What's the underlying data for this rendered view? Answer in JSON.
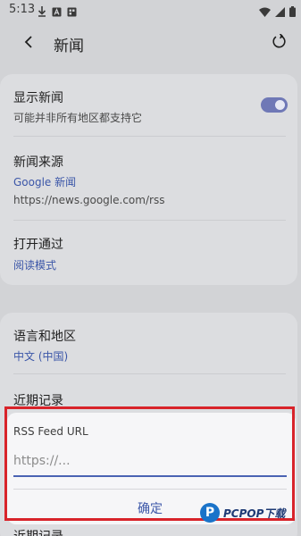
{
  "status_bar": {
    "time": "5:13",
    "icons": [
      "download-icon",
      "text-a-icon",
      "grid-app-icon",
      "wifi-icon",
      "signal-icon",
      "battery-icon"
    ]
  },
  "app_bar": {
    "title": "新闻",
    "back_icon": "chevron-left-icon",
    "reset_icon": "reset-icon"
  },
  "news_settings": {
    "show_news": {
      "title": "显示新闻",
      "subtitle": "可能并非所有地区都支持它",
      "enabled": true
    },
    "news_source": {
      "title": "新闻来源",
      "value": "Google 新闻",
      "url": "https://news.google.com/rss"
    },
    "open_via": {
      "title": "打开通过",
      "value": "阅读模式"
    }
  },
  "region_settings": {
    "language_region": {
      "title": "语言和地区",
      "value": "中文 (中国)"
    },
    "recent_records": {
      "title": "近期记录",
      "title_repeat": "近期记录"
    }
  },
  "dialog": {
    "title": "RSS Feed URL",
    "input_value": "",
    "input_placeholder": "https://...",
    "confirm_label": "确定"
  },
  "watermark": {
    "badge": "P",
    "text": "PCPOP下载"
  },
  "colors": {
    "accent": "#3b56a8",
    "toggle": "#6f78b6",
    "highlight": "#d8232a"
  }
}
